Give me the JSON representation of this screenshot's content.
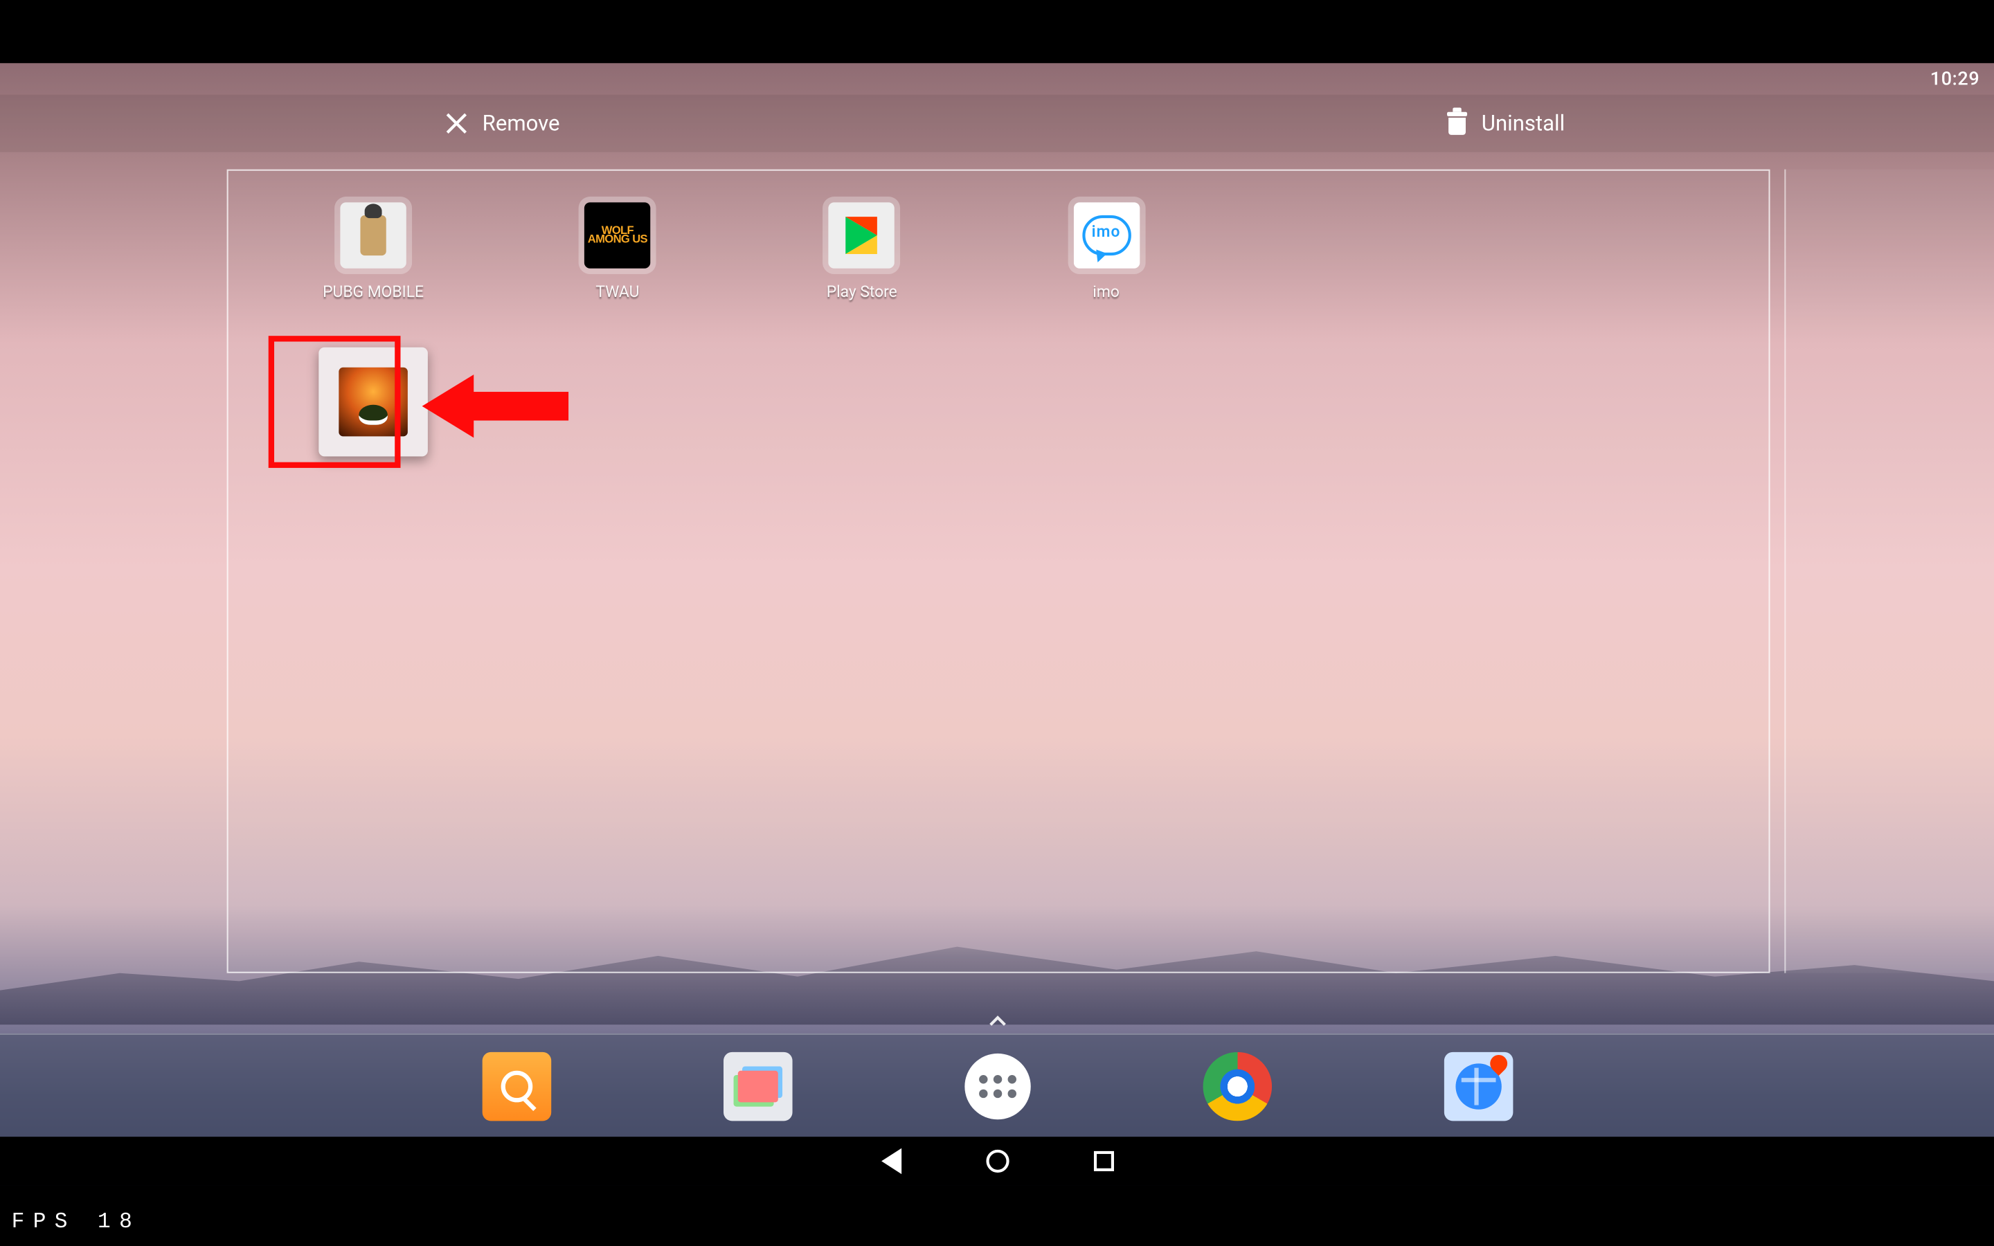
{
  "status": {
    "time": "10:29"
  },
  "actions": {
    "remove_label": "Remove",
    "uninstall_label": "Uninstall"
  },
  "apps": {
    "pubg": {
      "label": "PUBG MOBILE"
    },
    "twau": {
      "label": "TWAU",
      "tile_text": "WOLF AMONG US"
    },
    "play": {
      "label": "Play Store"
    },
    "imo": {
      "label": "imo",
      "bubble_text": "imo"
    }
  },
  "overlay": {
    "fps_label": "FPS",
    "fps_value": "18"
  }
}
